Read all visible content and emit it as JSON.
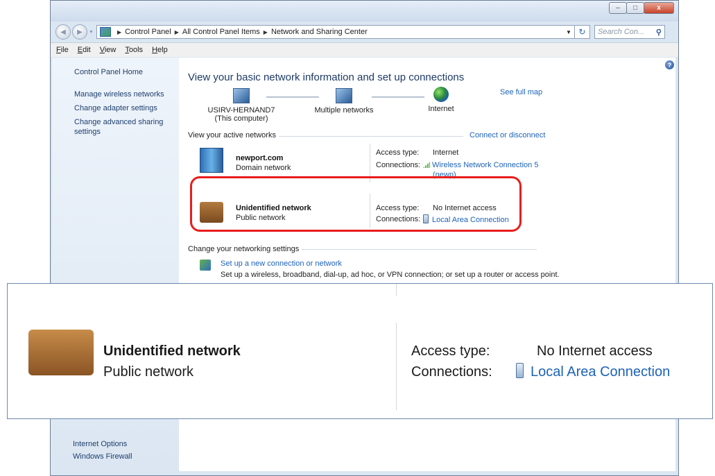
{
  "window": {
    "caption_buttons": {
      "minimize": "–",
      "maximize": "□",
      "close": "x"
    }
  },
  "address": {
    "crumbs": [
      "Control Panel",
      "All Control Panel Items",
      "Network and Sharing Center"
    ],
    "search_placeholder": "Search Con..."
  },
  "menu": [
    "File",
    "Edit",
    "View",
    "Tools",
    "Help"
  ],
  "sidebar": {
    "home": "Control Panel Home",
    "links": [
      "Manage wireless networks",
      "Change adapter settings",
      "Change advanced sharing settings"
    ],
    "see_also": [
      "Internet Options",
      "Windows Firewall"
    ]
  },
  "main": {
    "heading": "View your basic network information and set up connections",
    "see_full_map": "See full map",
    "map": {
      "computer": "USIRV-HERNAND7",
      "computer_sub": "(This computer)",
      "middle": "Multiple networks",
      "internet": "Internet"
    },
    "active_title": "View your active networks",
    "connect_link": "Connect or disconnect",
    "networks": [
      {
        "name": "newport.com",
        "type": "Domain network",
        "access_label": "Access type:",
        "access": "Internet",
        "conn_label": "Connections:",
        "conn": "Wireless Network Connection 5",
        "conn_extra": "(newp)"
      },
      {
        "name": "Unidentified network",
        "type": "Public network",
        "access_label": "Access type:",
        "access": "No Internet access",
        "conn_label": "Connections:",
        "conn": "Local Area Connection"
      }
    ],
    "change_title": "Change your networking settings",
    "setup_link": "Set up a new connection or network",
    "setup_desc": "Set up a wireless, broadband, dial-up, ad hoc, or VPN connection; or set up a router or access point."
  },
  "colors": {
    "highlight": "#e81d1d",
    "link": "#1d62b8"
  }
}
